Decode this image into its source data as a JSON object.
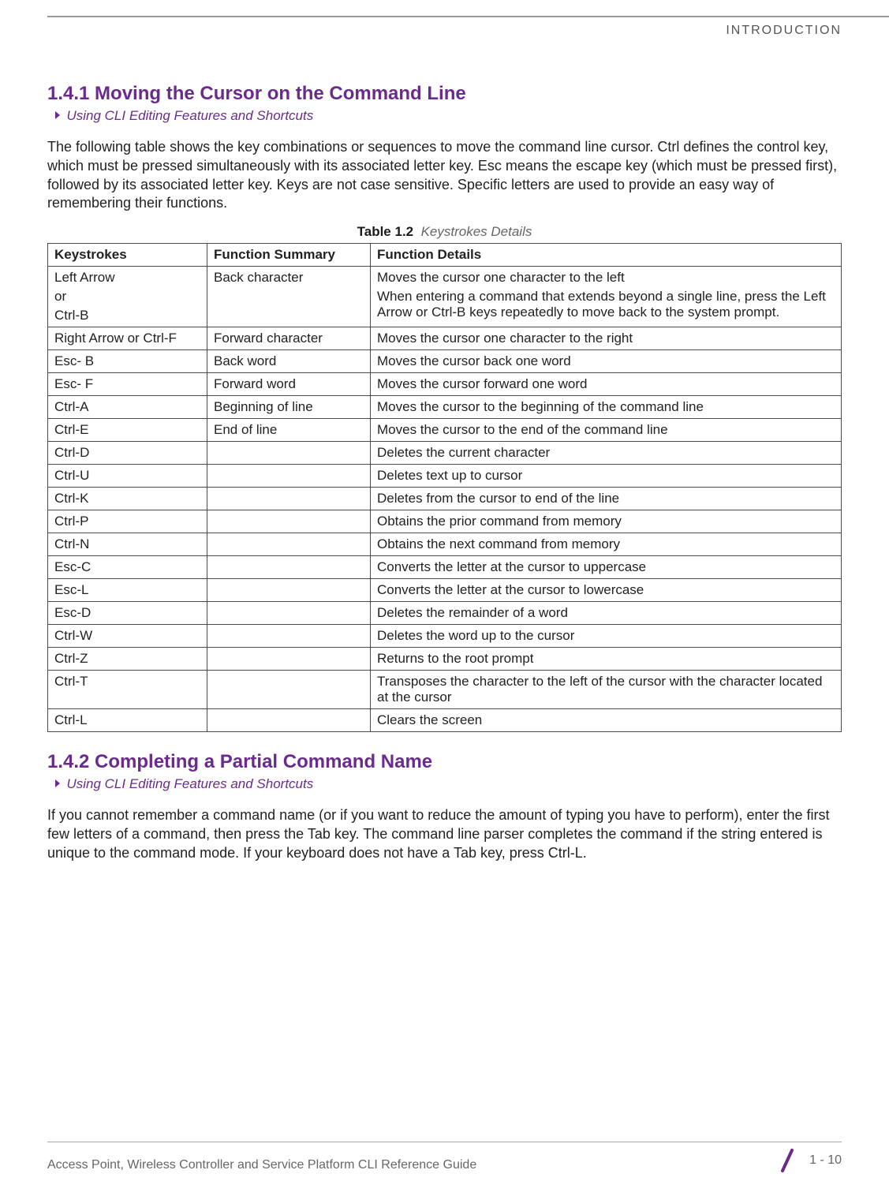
{
  "header": {
    "section_label": "INTRODUCTION"
  },
  "sections": {
    "s141": {
      "heading": "1.4.1 Moving the Cursor on the Command Line",
      "crumb": "Using CLI Editing Features and Shortcuts",
      "para": "The following table shows the key combinations or sequences to move the command line cursor. Ctrl defines the control key, which must be pressed simultaneously with its associated letter key. Esc means the escape key (which must be pressed first), followed by its associated letter key. Keys are not case sensitive. Specific letters are used to provide an easy way of remembering their functions."
    },
    "s142": {
      "heading": "1.4.2 Completing a Partial Command Name",
      "crumb": "Using CLI Editing Features and Shortcuts",
      "para": "If you cannot remember a command name (or if you want to reduce the amount of typing you have to perform), enter the first few letters of a command, then press the Tab key. The command line parser completes the command if the string entered is unique to the command mode. If your keyboard does not have a Tab key, press Ctrl-L."
    }
  },
  "table": {
    "caption_bold": "Table 1.2",
    "caption_italic": "Keystrokes Details",
    "headers": {
      "c1": "Keystrokes",
      "c2": "Function Summary",
      "c3": "Function Details"
    },
    "rows": [
      {
        "k_line1": "Left Arrow",
        "k_line2": "or",
        "k_line3": "Ctrl-B",
        "s": "Back character",
        "d_line1": "Moves the cursor one character to the left",
        "d_line2": "When entering a command that extends beyond a single line, press the Left Arrow or Ctrl-B keys repeatedly to move back to the system prompt."
      },
      {
        "k": "Right Arrow or Ctrl-F",
        "s": "Forward character",
        "d": "Moves the cursor one character to the right"
      },
      {
        "k": "Esc- B",
        "s": "Back word",
        "d": "Moves the cursor back one word"
      },
      {
        "k": "Esc- F",
        "s": "Forward word",
        "d": "Moves the cursor forward one word"
      },
      {
        "k": "Ctrl-A",
        "s": "Beginning of line",
        "d": "Moves the cursor to the beginning of the command line"
      },
      {
        "k": "Ctrl-E",
        "s": "End of line",
        "d": "Moves the cursor to the end of the command line"
      },
      {
        "k": "Ctrl-D",
        "s": "",
        "d": "Deletes the current character"
      },
      {
        "k": "Ctrl-U",
        "s": "",
        "d": "Deletes text up to cursor"
      },
      {
        "k": "Ctrl-K",
        "s": "",
        "d": "Deletes from the cursor to end of the line"
      },
      {
        "k": "Ctrl-P",
        "s": "",
        "d": "Obtains the prior command from memory"
      },
      {
        "k": "Ctrl-N",
        "s": "",
        "d": "Obtains the next command from memory"
      },
      {
        "k": "Esc-C",
        "s": "",
        "d": "Converts the letter at the cursor to uppercase"
      },
      {
        "k": "Esc-L",
        "s": "",
        "d": "Converts the letter at the cursor to lowercase"
      },
      {
        "k": "Esc-D",
        "s": "",
        "d": "Deletes the remainder of a word"
      },
      {
        "k": "Ctrl-W",
        "s": "",
        "d": "Deletes the word up to the cursor"
      },
      {
        "k": "Ctrl-Z",
        "s": "",
        "d": "Returns to the root prompt"
      },
      {
        "k": "Ctrl-T",
        "s": "",
        "d": "Transposes the character to the left of the cursor with the character located at the cursor"
      },
      {
        "k": "Ctrl-L",
        "s": "",
        "d": "Clears the screen"
      }
    ]
  },
  "footer": {
    "left": "Access Point, Wireless Controller and Service Platform CLI Reference Guide",
    "right": "1 - 10"
  }
}
